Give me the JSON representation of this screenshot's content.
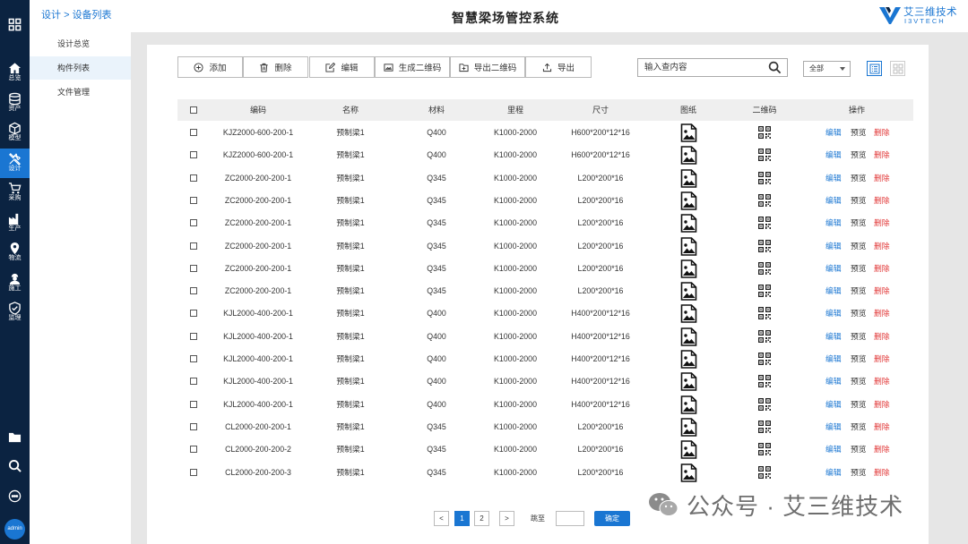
{
  "rail": {
    "items": [
      {
        "label": "总览",
        "icon": "home-icon"
      },
      {
        "label": "资产",
        "icon": "database-icon"
      },
      {
        "label": "模型",
        "icon": "cube-icon"
      },
      {
        "label": "设计",
        "icon": "tools-icon"
      },
      {
        "label": "采购",
        "icon": "cart-icon"
      },
      {
        "label": "生产",
        "icon": "factory-icon"
      },
      {
        "label": "物流",
        "icon": "location-pin-icon"
      },
      {
        "label": "施工",
        "icon": "worker-icon"
      },
      {
        "label": "监理",
        "icon": "shield-check-icon"
      }
    ],
    "active": "设计",
    "bottom_icons": [
      "folder-icon",
      "search-icon",
      "chat-icon"
    ],
    "avatar_label": "admin"
  },
  "breadcrumb": {
    "parent": "设计",
    "separator": ">",
    "current": "设备列表"
  },
  "subnav": {
    "items": [
      "设计总览",
      "构件列表",
      "文件管理"
    ],
    "active": "构件列表"
  },
  "header": {
    "title": "智慧梁场管控系统",
    "logo_name": "艾三维技术",
    "logo_sub": "I3VTECH"
  },
  "toolbar": {
    "add": "添加",
    "delete": "删除",
    "edit": "编辑",
    "gen_qr": "生成二维码",
    "export_qr": "导出二维码",
    "export": "导出"
  },
  "search": {
    "placeholder": "输入查内容"
  },
  "scope": {
    "selected": "全部"
  },
  "table": {
    "columns": [
      "编码",
      "名称",
      "材料",
      "里程",
      "尺寸",
      "图纸",
      "二维码",
      "操作"
    ],
    "rows": [
      {
        "code": "KJZ2000-600-200-1",
        "name": "预制梁1",
        "material": "Q400",
        "mileage": "K1000-2000",
        "size": "H600*200*12*16"
      },
      {
        "code": "KJZ2000-600-200-1",
        "name": "预制梁1",
        "material": "Q400",
        "mileage": "K1000-2000",
        "size": "H600*200*12*16"
      },
      {
        "code": "ZC2000-200-200-1",
        "name": "预制梁1",
        "material": "Q345",
        "mileage": "K1000-2000",
        "size": "L200*200*16"
      },
      {
        "code": "ZC2000-200-200-1",
        "name": "预制梁1",
        "material": "Q345",
        "mileage": "K1000-2000",
        "size": "L200*200*16"
      },
      {
        "code": "ZC2000-200-200-1",
        "name": "预制梁1",
        "material": "Q345",
        "mileage": "K1000-2000",
        "size": "L200*200*16"
      },
      {
        "code": "ZC2000-200-200-1",
        "name": "预制梁1",
        "material": "Q345",
        "mileage": "K1000-2000",
        "size": "L200*200*16"
      },
      {
        "code": "ZC2000-200-200-1",
        "name": "预制梁1",
        "material": "Q345",
        "mileage": "K1000-2000",
        "size": "L200*200*16"
      },
      {
        "code": "ZC2000-200-200-1",
        "name": "预制梁1",
        "material": "Q345",
        "mileage": "K1000-2000",
        "size": "L200*200*16"
      },
      {
        "code": "KJL2000-400-200-1",
        "name": "预制梁1",
        "material": "Q400",
        "mileage": "K1000-2000",
        "size": "H400*200*12*16"
      },
      {
        "code": "KJL2000-400-200-1",
        "name": "预制梁1",
        "material": "Q400",
        "mileage": "K1000-2000",
        "size": "H400*200*12*16"
      },
      {
        "code": "KJL2000-400-200-1",
        "name": "预制梁1",
        "material": "Q400",
        "mileage": "K1000-2000",
        "size": "H400*200*12*16"
      },
      {
        "code": "KJL2000-400-200-1",
        "name": "预制梁1",
        "material": "Q400",
        "mileage": "K1000-2000",
        "size": "H400*200*12*16"
      },
      {
        "code": "KJL2000-400-200-1",
        "name": "预制梁1",
        "material": "Q400",
        "mileage": "K1000-2000",
        "size": "H400*200*12*16"
      },
      {
        "code": "CL2000-200-200-1",
        "name": "预制梁1",
        "material": "Q345",
        "mileage": "K1000-2000",
        "size": "L200*200*16"
      },
      {
        "code": "CL2000-200-200-2",
        "name": "预制梁1",
        "material": "Q345",
        "mileage": "K1000-2000",
        "size": "L200*200*16"
      },
      {
        "code": "CL2000-200-200-3",
        "name": "预制梁1",
        "material": "Q345",
        "mileage": "K1000-2000",
        "size": "L200*200*16"
      }
    ],
    "actions": {
      "edit": "编辑",
      "preview": "预览",
      "delete": "删除"
    }
  },
  "pagination": {
    "prev": "<",
    "next": ">",
    "pages": [
      "1",
      "2"
    ],
    "current": "1",
    "jump_label": "跳至",
    "confirm": "确定"
  },
  "watermark": {
    "text": "公众号 · 艾三维技术"
  },
  "colors": {
    "rail_bg": "#0b2341",
    "accent": "#1a76d2",
    "danger": "#e23b3b",
    "content_bg": "#e6e6e6"
  }
}
